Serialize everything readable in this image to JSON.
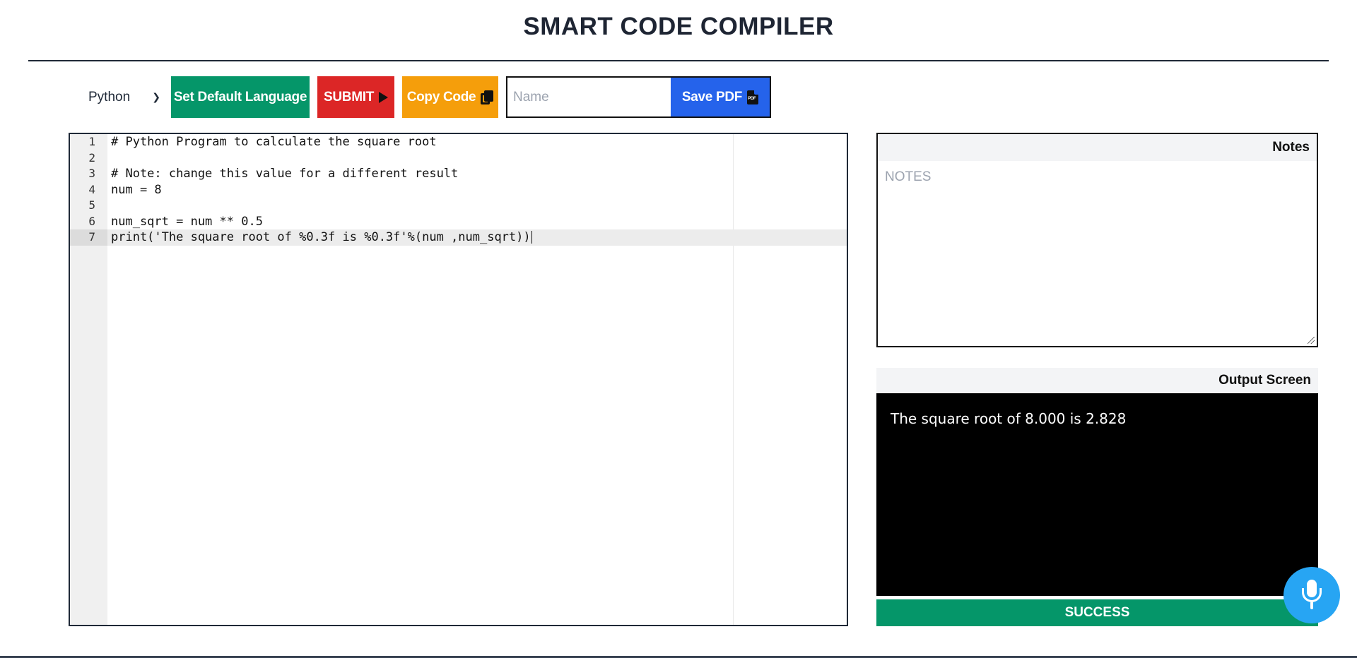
{
  "page": {
    "title": "SMART CODE COMPILER"
  },
  "toolbar": {
    "language_selected": "Python",
    "set_default_label": "Set Default Language",
    "submit_label": "SUBMIT",
    "copy_label": "Copy Code",
    "name_placeholder": "Name",
    "save_pdf_label": "Save PDF"
  },
  "editor": {
    "lines": [
      {
        "num": "1",
        "text": "# Python Program to calculate the square root"
      },
      {
        "num": "2",
        "text": ""
      },
      {
        "num": "3",
        "text": "# Note: change this value for a different result"
      },
      {
        "num": "4",
        "text": "num = 8"
      },
      {
        "num": "5",
        "text": ""
      },
      {
        "num": "6",
        "text": "num_sqrt = num ** 0.5"
      },
      {
        "num": "7",
        "text": "print('The square root of %0.3f is %0.3f'%(num ,num_sqrt))"
      }
    ],
    "active_line": 7
  },
  "notes": {
    "title": "Notes",
    "placeholder": "NOTES"
  },
  "output": {
    "title": "Output Screen",
    "text": "The square root of 8.000 is 2.828",
    "status": "SUCCESS"
  },
  "colors": {
    "set_default": "#059669",
    "submit": "#dc2626",
    "copy": "#f59e0b",
    "save_pdf": "#2563eb",
    "success": "#059669",
    "mic": "#27a5f3"
  },
  "icons": {
    "submit": "play-icon",
    "copy": "copy-icon",
    "save_pdf": "pdf-file-icon",
    "language": "chevron-down-icon",
    "mic": "microphone-icon"
  }
}
